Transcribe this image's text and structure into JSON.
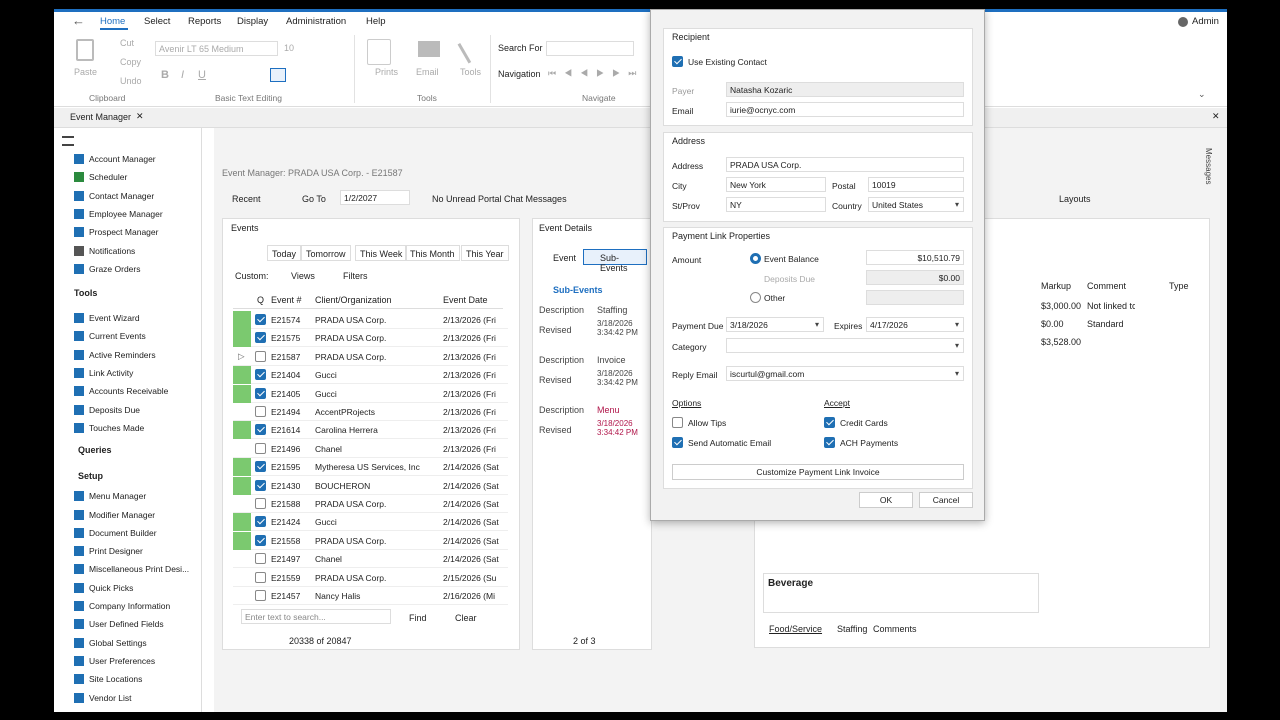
{
  "menu": {
    "back": "←",
    "items": [
      "Home",
      "Select",
      "Reports",
      "Display",
      "Administration",
      "Help"
    ],
    "user": "Admin"
  },
  "ribbon": {
    "paste": "Paste",
    "cut": "Cut",
    "copy": "Copy",
    "undo": "Undo",
    "font": "Avenir LT 65 Medium",
    "size": "10",
    "prints": "Prints",
    "email": "Email",
    "tools": "Tools",
    "search_for": "Search For",
    "navigation": "Navigation",
    "groups": {
      "clipboard": "Clipboard",
      "basic": "Basic Text Editing",
      "tools": "Tools",
      "navigate": "Navigate"
    }
  },
  "doc_tab": "Event Manager",
  "sidebar": {
    "items1": [
      "Account Manager",
      "Scheduler",
      "Contact Manager",
      "Employee Manager",
      "Prospect Manager",
      "Notifications",
      "Graze Orders"
    ],
    "tools_header": "Tools",
    "tools": [
      "Event Wizard",
      "Current Events",
      "Active Reminders",
      "Link Activity",
      "Accounts Receivable",
      "Deposits Due",
      "Touches Made"
    ],
    "queries_header": "Queries",
    "setup_header": "Setup",
    "setup": [
      "Menu Manager",
      "Modifier Manager",
      "Document Builder",
      "Print Designer",
      "Miscellaneous Print Desi...",
      "Quick Picks",
      "Company Information",
      "User Defined Fields",
      "Global Settings",
      "User Preferences",
      "Site Locations",
      "Vendor List"
    ]
  },
  "em": {
    "title": "Event Manager: PRADA USA Corp. - E21587",
    "recent": "Recent",
    "goto": "Go To",
    "date": "1/2/2027",
    "chat": "No Unread Portal Chat Messages",
    "layouts": "Layouts"
  },
  "events": {
    "title": "Events",
    "tabs": [
      "Today",
      "Tomorrow",
      "This Week",
      "This Month",
      "This Year"
    ],
    "custom": "Custom:",
    "views": "Views",
    "filters": "Filters",
    "cols": [
      "Q",
      "Event #",
      "Client/Organization",
      "Event Date"
    ],
    "rows": [
      {
        "g": true,
        "c": true,
        "n": "E21574",
        "o": "PRADA USA Corp.",
        "d": "2/13/2026 (Fri"
      },
      {
        "g": true,
        "c": true,
        "n": "E21575",
        "o": "PRADA USA Corp.",
        "d": "2/13/2026 (Fri"
      },
      {
        "g": false,
        "c": false,
        "x": true,
        "n": "E21587",
        "o": "PRADA USA Corp.",
        "d": "2/13/2026 (Fri"
      },
      {
        "g": true,
        "c": true,
        "n": "E21404",
        "o": "Gucci",
        "d": "2/13/2026 (Fri"
      },
      {
        "g": true,
        "c": true,
        "n": "E21405",
        "o": "Gucci",
        "d": "2/13/2026 (Fri"
      },
      {
        "g": false,
        "c": false,
        "n": "E21494",
        "o": "AccentPRojects",
        "d": "2/13/2026 (Fri"
      },
      {
        "g": true,
        "c": true,
        "n": "E21614",
        "o": "Carolina Herrera",
        "d": "2/13/2026 (Fri"
      },
      {
        "g": false,
        "c": false,
        "n": "E21496",
        "o": "Chanel",
        "d": "2/13/2026 (Fri"
      },
      {
        "g": true,
        "c": true,
        "n": "E21595",
        "o": "Mytheresa US Services, Inc",
        "d": "2/14/2026 (Sat"
      },
      {
        "g": true,
        "c": true,
        "n": "E21430",
        "o": "BOUCHERON",
        "d": "2/14/2026 (Sat"
      },
      {
        "g": false,
        "c": false,
        "n": "E21588",
        "o": "PRADA USA Corp.",
        "d": "2/14/2026 (Sat"
      },
      {
        "g": true,
        "c": true,
        "n": "E21424",
        "o": "Gucci",
        "d": "2/14/2026 (Sat"
      },
      {
        "g": true,
        "c": true,
        "n": "E21558",
        "o": "PRADA USA Corp.",
        "d": "2/14/2026 (Sat"
      },
      {
        "g": false,
        "c": false,
        "n": "E21497",
        "o": "Chanel",
        "d": "2/14/2026 (Sat"
      },
      {
        "g": false,
        "c": false,
        "n": "E21559",
        "o": "PRADA USA Corp.",
        "d": "2/15/2026 (Su"
      },
      {
        "g": false,
        "c": false,
        "n": "E21457",
        "o": "Nancy Halis",
        "d": "2/16/2026 (Mi"
      }
    ],
    "search_ph": "Enter text to search...",
    "find": "Find",
    "clear": "Clear",
    "pager": "20338 of 20847"
  },
  "details": {
    "title": "Event Details",
    "tab_event": "Event",
    "tab_sub": "Sub-Events",
    "sub_header": "Sub-Events",
    "cards": [
      {
        "desc": "Staffing",
        "rev": "3/18/2026 3:34:42 PM",
        "red": false
      },
      {
        "desc": "Invoice",
        "rev": "3/18/2026 3:34:42 PM",
        "red": false
      },
      {
        "desc": "Menu",
        "rev": "3/18/2026 3:34:42 PM",
        "red": true
      }
    ],
    "desc_lbl": "Description",
    "rev_lbl": "Revised",
    "pager": "2 of 3"
  },
  "grid": {
    "cols": [
      "Markup",
      "Comment",
      "Type"
    ],
    "rows": [
      {
        "m": "$3,000.00",
        "c": "Not linked tc"
      },
      {
        "m": "$0.00",
        "c": "Standard"
      },
      {
        "m": "$3,528.00",
        "c": ""
      }
    ],
    "beverage": "Beverage",
    "tabs": [
      "Food/Service",
      "Staffing",
      "Comments"
    ]
  },
  "dialog": {
    "recipient": "Recipient",
    "use_existing": "Use Existing Contact",
    "payer_lbl": "Payer",
    "payer": "Natasha Kozaric",
    "email_lbl": "Email",
    "email": "iurie@ocnyc.com",
    "address_hdr": "Address",
    "address_lbl": "Address",
    "address": "PRADA USA Corp.",
    "city_lbl": "City",
    "city": "New York",
    "postal_lbl": "Postal",
    "postal": "10019",
    "st_lbl": "St/Prov",
    "st": "NY",
    "country_lbl": "Country",
    "country": "United States",
    "plp": "Payment Link Properties",
    "amount_lbl": "Amount",
    "event_balance": "Event Balance",
    "event_balance_val": "$10,510.79",
    "deposits_due": "Deposits Due",
    "deposits_val": "$0.00",
    "other": "Other",
    "payment_due_lbl": "Payment Due",
    "payment_due": "3/18/2026",
    "expires_lbl": "Expires",
    "expires": "4/17/2026",
    "category_lbl": "Category",
    "reply_lbl": "Reply Email",
    "reply": "iscurtul@gmail.com",
    "options": "Options",
    "allow_tips": "Allow Tips",
    "send_auto": "Send Automatic Email",
    "accept": "Accept",
    "credit": "Credit Cards",
    "ach": "ACH Payments",
    "customize": "Customize Payment Link Invoice",
    "ok": "OK",
    "cancel": "Cancel"
  },
  "messages": "Messages",
  "colors": {
    "accent": "#1f6fb3",
    "green": "#7bc96f"
  }
}
